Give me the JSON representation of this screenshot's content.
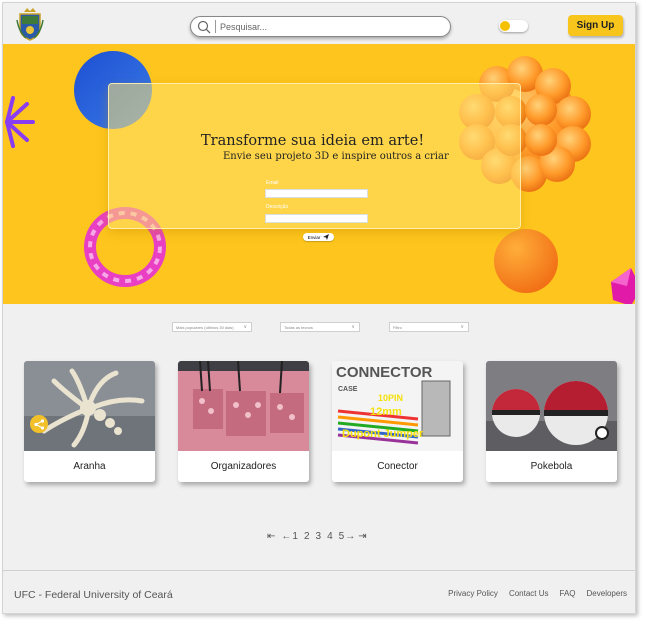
{
  "header": {
    "search_placeholder": "Pesquisar...",
    "signup_label": "Sign Up"
  },
  "hero": {
    "title": "Transforme sua ideia em arte!",
    "subtitle": "Envie seu projeto 3D e inspire outros a criar",
    "email_label": "Email",
    "description_label": "Descrição",
    "send_label": "Enviar"
  },
  "filters": [
    {
      "label": "Mais populares (últimos 30 dias)"
    },
    {
      "label": "Todas as tecnos"
    },
    {
      "label": "Filtro"
    }
  ],
  "cards": [
    {
      "label": "Aranha"
    },
    {
      "label": "Organizadores"
    },
    {
      "label": "Conector"
    },
    {
      "label": "Pokebola"
    }
  ],
  "card_image_text": {
    "connector_title": "CONNECTOR",
    "connector_case": "CASE",
    "connector_pin": "10PIN",
    "connector_mm": "12mm",
    "connector_jumper": "Dupont Jumper"
  },
  "pagination": {
    "first": "⇤",
    "prev": "←",
    "pages": [
      "1",
      "2",
      "3",
      "4",
      "5"
    ],
    "next": "→",
    "last": "⇥"
  },
  "footer": {
    "title": "UFC - Federal University of Ceará",
    "links": [
      "Privacy Policy",
      "Contact Us",
      "FAQ",
      "Developers"
    ]
  },
  "colors": {
    "brand_yellow": "#fdc51d",
    "button_yellow": "#f7c51c",
    "background": "#f0f0f0"
  },
  "icons": [
    "logo-crest",
    "search-icon",
    "send-icon",
    "share-icon",
    "chevron-down-icon"
  ]
}
